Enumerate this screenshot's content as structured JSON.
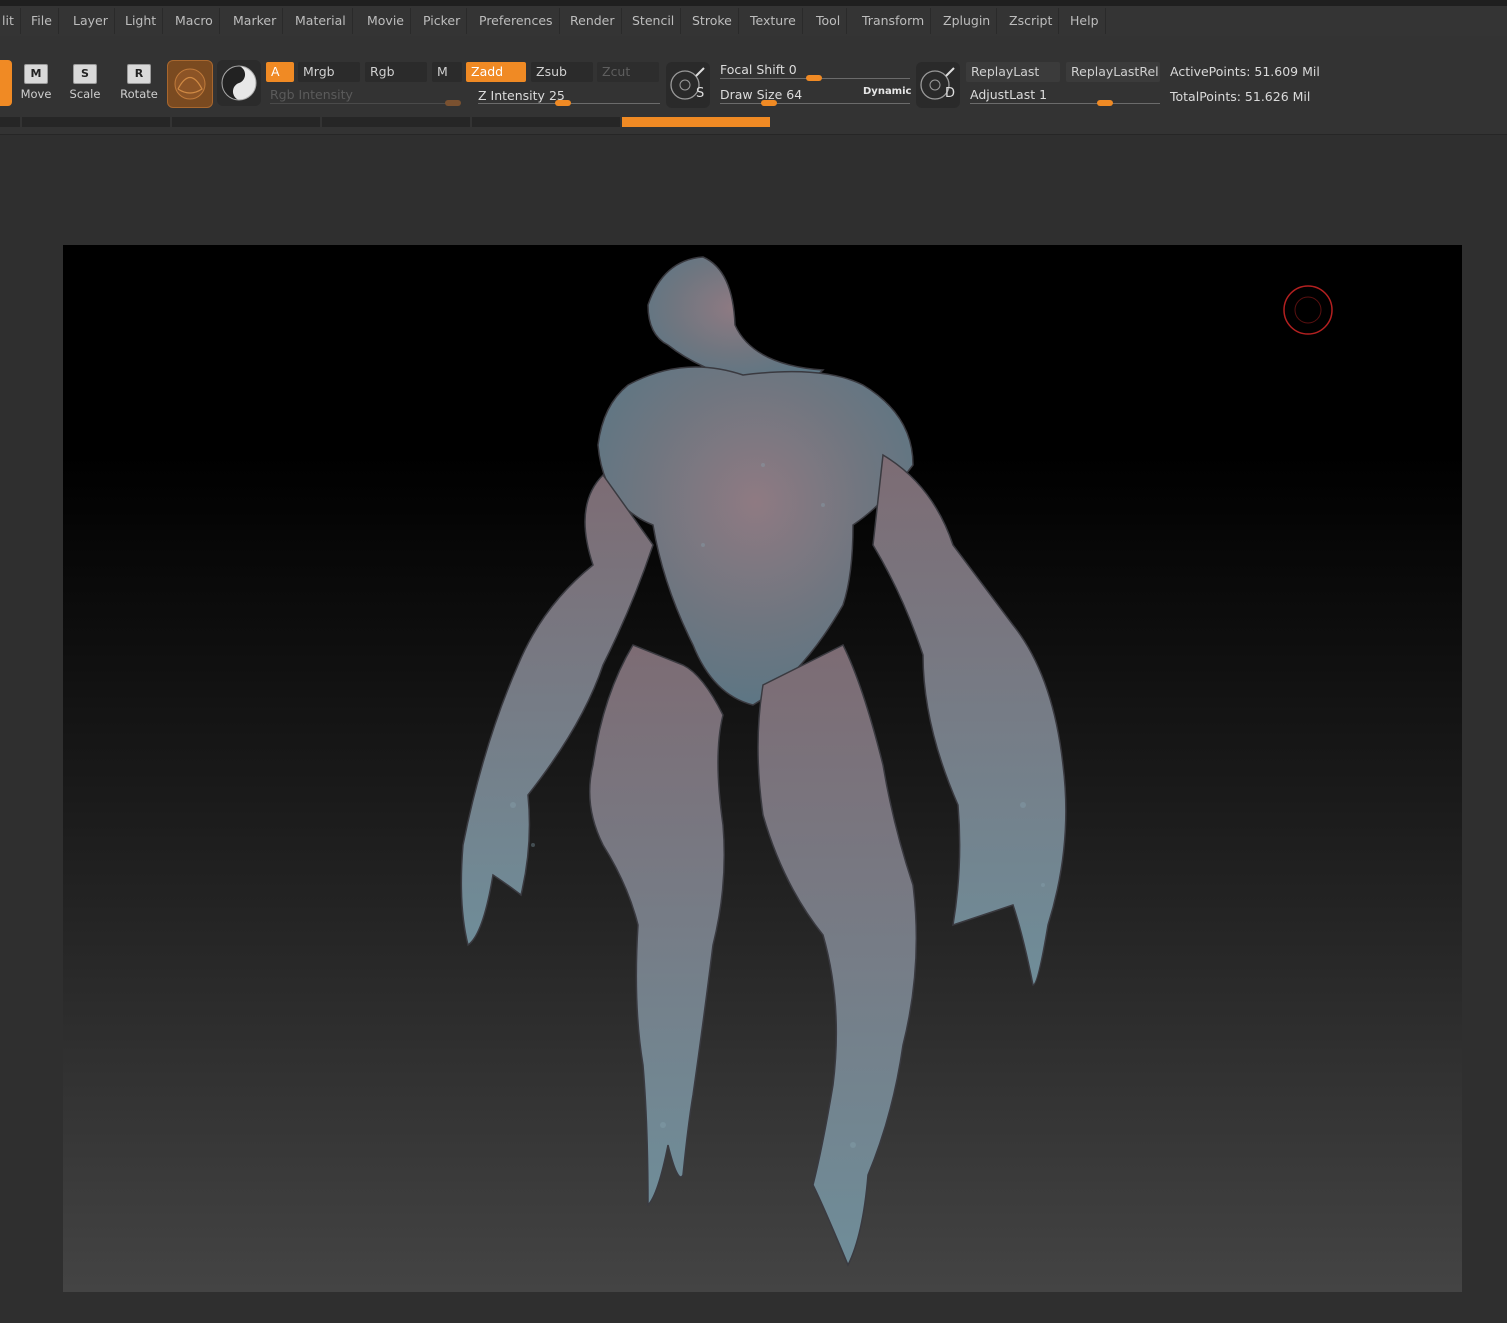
{
  "menu": [
    "lit",
    "File",
    "Layer",
    "Light",
    "Macro",
    "Marker",
    "Material",
    "Movie",
    "Picker",
    "Preferences",
    "Render",
    "Stencil",
    "Stroke",
    "Texture",
    "Tool",
    "Transform",
    "Zplugin",
    "Zscript",
    "Help"
  ],
  "transform": {
    "move": "Move",
    "scale": "Scale",
    "rotate": "Rotate",
    "move_key": "M",
    "scale_key": "S",
    "rotate_key": "R"
  },
  "modes": {
    "a": "A",
    "mrgb": "Mrgb",
    "rgb": "Rgb",
    "m": "M",
    "zadd": "Zadd",
    "zsub": "Zsub",
    "zcut": "Zcut"
  },
  "sliders": {
    "rgb_intensity_label": "Rgb Intensity",
    "z_intensity_label": "Z Intensity",
    "z_intensity_value": "25",
    "focal_shift_label": "Focal Shift",
    "focal_shift_value": "0",
    "draw_size_label": "Draw Size",
    "draw_size_value": "64",
    "dynamic_label": "Dynamic",
    "adjust_last_label": "AdjustLast",
    "adjust_last_value": "1"
  },
  "stroke_markers": {
    "s": "S",
    "d": "D"
  },
  "replay": {
    "replay_last": "ReplayLast",
    "replay_last_rel": "ReplayLastRel"
  },
  "stats": {
    "active_points": "ActivePoints: 51.609 Mil",
    "total_points": "TotalPoints: 51.626 Mil"
  },
  "colors": {
    "accent": "#f08a24",
    "menubar": "#343434",
    "toolbar": "#333333",
    "canvas_top": "#000000",
    "canvas_bottom": "#444444"
  }
}
